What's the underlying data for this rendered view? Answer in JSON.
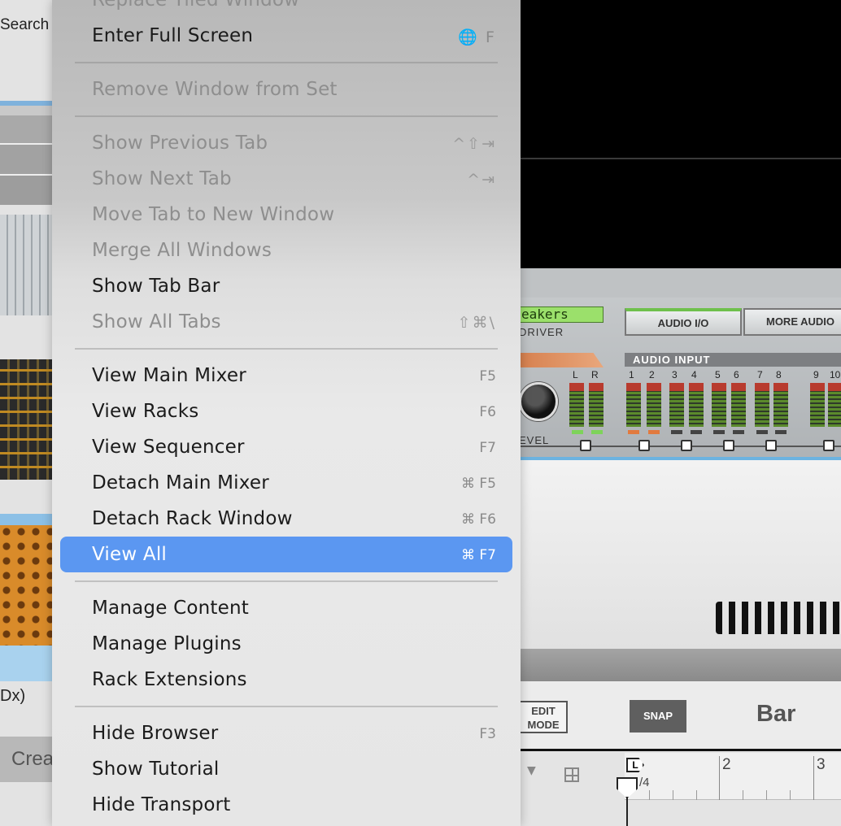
{
  "left_panel": {
    "search_label": "Search",
    "device_label": "Dx)",
    "create_label": "Crea"
  },
  "background_app": {
    "lcd_text": "eakers",
    "driver_label": "DRIVER",
    "audio_io_label": "AUDIO I/O",
    "more_audio_label": "MORE AUDIO",
    "audio_input_label": "AUDIO INPUT",
    "meter_labels": [
      "L",
      "R",
      "1",
      "2",
      "3",
      "4",
      "5",
      "6",
      "7",
      "8",
      "9",
      "10"
    ],
    "level_label": "EVEL",
    "edit_mode_label": "EDIT MODE",
    "snap_label": "SNAP",
    "bar_label": "Bar",
    "ruler_numbers": [
      "2",
      "3"
    ],
    "loop_marker_label": "L",
    "time_signature": "/4",
    "colors": {
      "menu_highlight": "#5b97f1",
      "audio_io_indicator": "#6ec04c",
      "timeline_accent": "#6cb3e0"
    }
  },
  "menu": {
    "groups": [
      [
        {
          "label": "Replace Tiled Window",
          "shortcut": "",
          "enabled": false,
          "partial": true
        },
        {
          "label": "Enter Full Screen",
          "shortcut": "🌐 F",
          "enabled": true
        }
      ],
      [
        {
          "label": "Remove Window from Set",
          "shortcut": "",
          "enabled": false
        }
      ],
      [
        {
          "label": "Show Previous Tab",
          "shortcut": "^⇧⇥",
          "enabled": false
        },
        {
          "label": "Show Next Tab",
          "shortcut": "^⇥",
          "enabled": false
        },
        {
          "label": "Move Tab to New Window",
          "shortcut": "",
          "enabled": false
        },
        {
          "label": "Merge All Windows",
          "shortcut": "",
          "enabled": false
        },
        {
          "label": "Show Tab Bar",
          "shortcut": "",
          "enabled": true
        },
        {
          "label": "Show All Tabs",
          "shortcut": "⇧⌘\\",
          "enabled": false
        }
      ],
      [
        {
          "label": "View Main Mixer",
          "shortcut": "F5",
          "enabled": true
        },
        {
          "label": "View Racks",
          "shortcut": "F6",
          "enabled": true
        },
        {
          "label": "View Sequencer",
          "shortcut": "F7",
          "enabled": true
        },
        {
          "label": "Detach Main Mixer",
          "shortcut": "⌘ F5",
          "enabled": true
        },
        {
          "label": "Detach Rack Window",
          "shortcut": "⌘ F6",
          "enabled": true
        },
        {
          "label": "View All",
          "shortcut": "⌘ F7",
          "enabled": true,
          "selected": true
        }
      ],
      [
        {
          "label": "Manage Content",
          "shortcut": "",
          "enabled": true
        },
        {
          "label": "Manage Plugins",
          "shortcut": "",
          "enabled": true
        },
        {
          "label": "Rack Extensions",
          "shortcut": "",
          "enabled": true
        }
      ],
      [
        {
          "label": "Hide Browser",
          "shortcut": "F3",
          "enabled": true
        },
        {
          "label": "Show Tutorial",
          "shortcut": "",
          "enabled": true
        },
        {
          "label": "Hide Transport",
          "shortcut": "",
          "enabled": true
        }
      ]
    ]
  }
}
